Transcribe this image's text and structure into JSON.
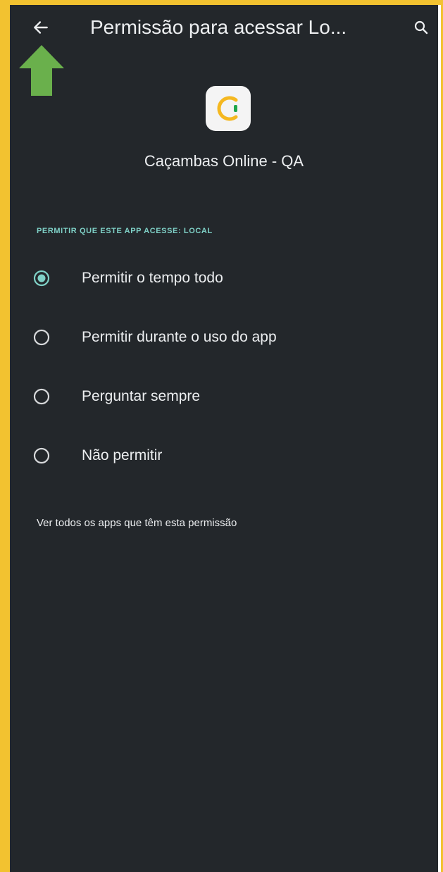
{
  "header": {
    "title": "Permissão para acessar Lo...",
    "back_icon": "arrow-left-icon",
    "search_icon": "search-icon"
  },
  "app": {
    "name": "Caçambas Online - QA",
    "icon": "app-logo-icon"
  },
  "permission": {
    "section_title": "PERMITIR QUE ESTE APP ACESSE: LOCAL",
    "options": [
      {
        "label": "Permitir o tempo todo",
        "selected": true
      },
      {
        "label": "Permitir durante o uso do app",
        "selected": false
      },
      {
        "label": "Perguntar sempre",
        "selected": false
      },
      {
        "label": "Não permitir",
        "selected": false
      }
    ]
  },
  "see_all_link": "Ver todos os apps que têm esta permissão",
  "colors": {
    "frame_border": "#f2c230",
    "background": "#23272b",
    "text": "#eceef0",
    "accent": "#7fd1c7",
    "arrow_annotation": "#6ab04c",
    "logo_yellow": "#f5b820",
    "logo_green": "#1fa64a"
  }
}
